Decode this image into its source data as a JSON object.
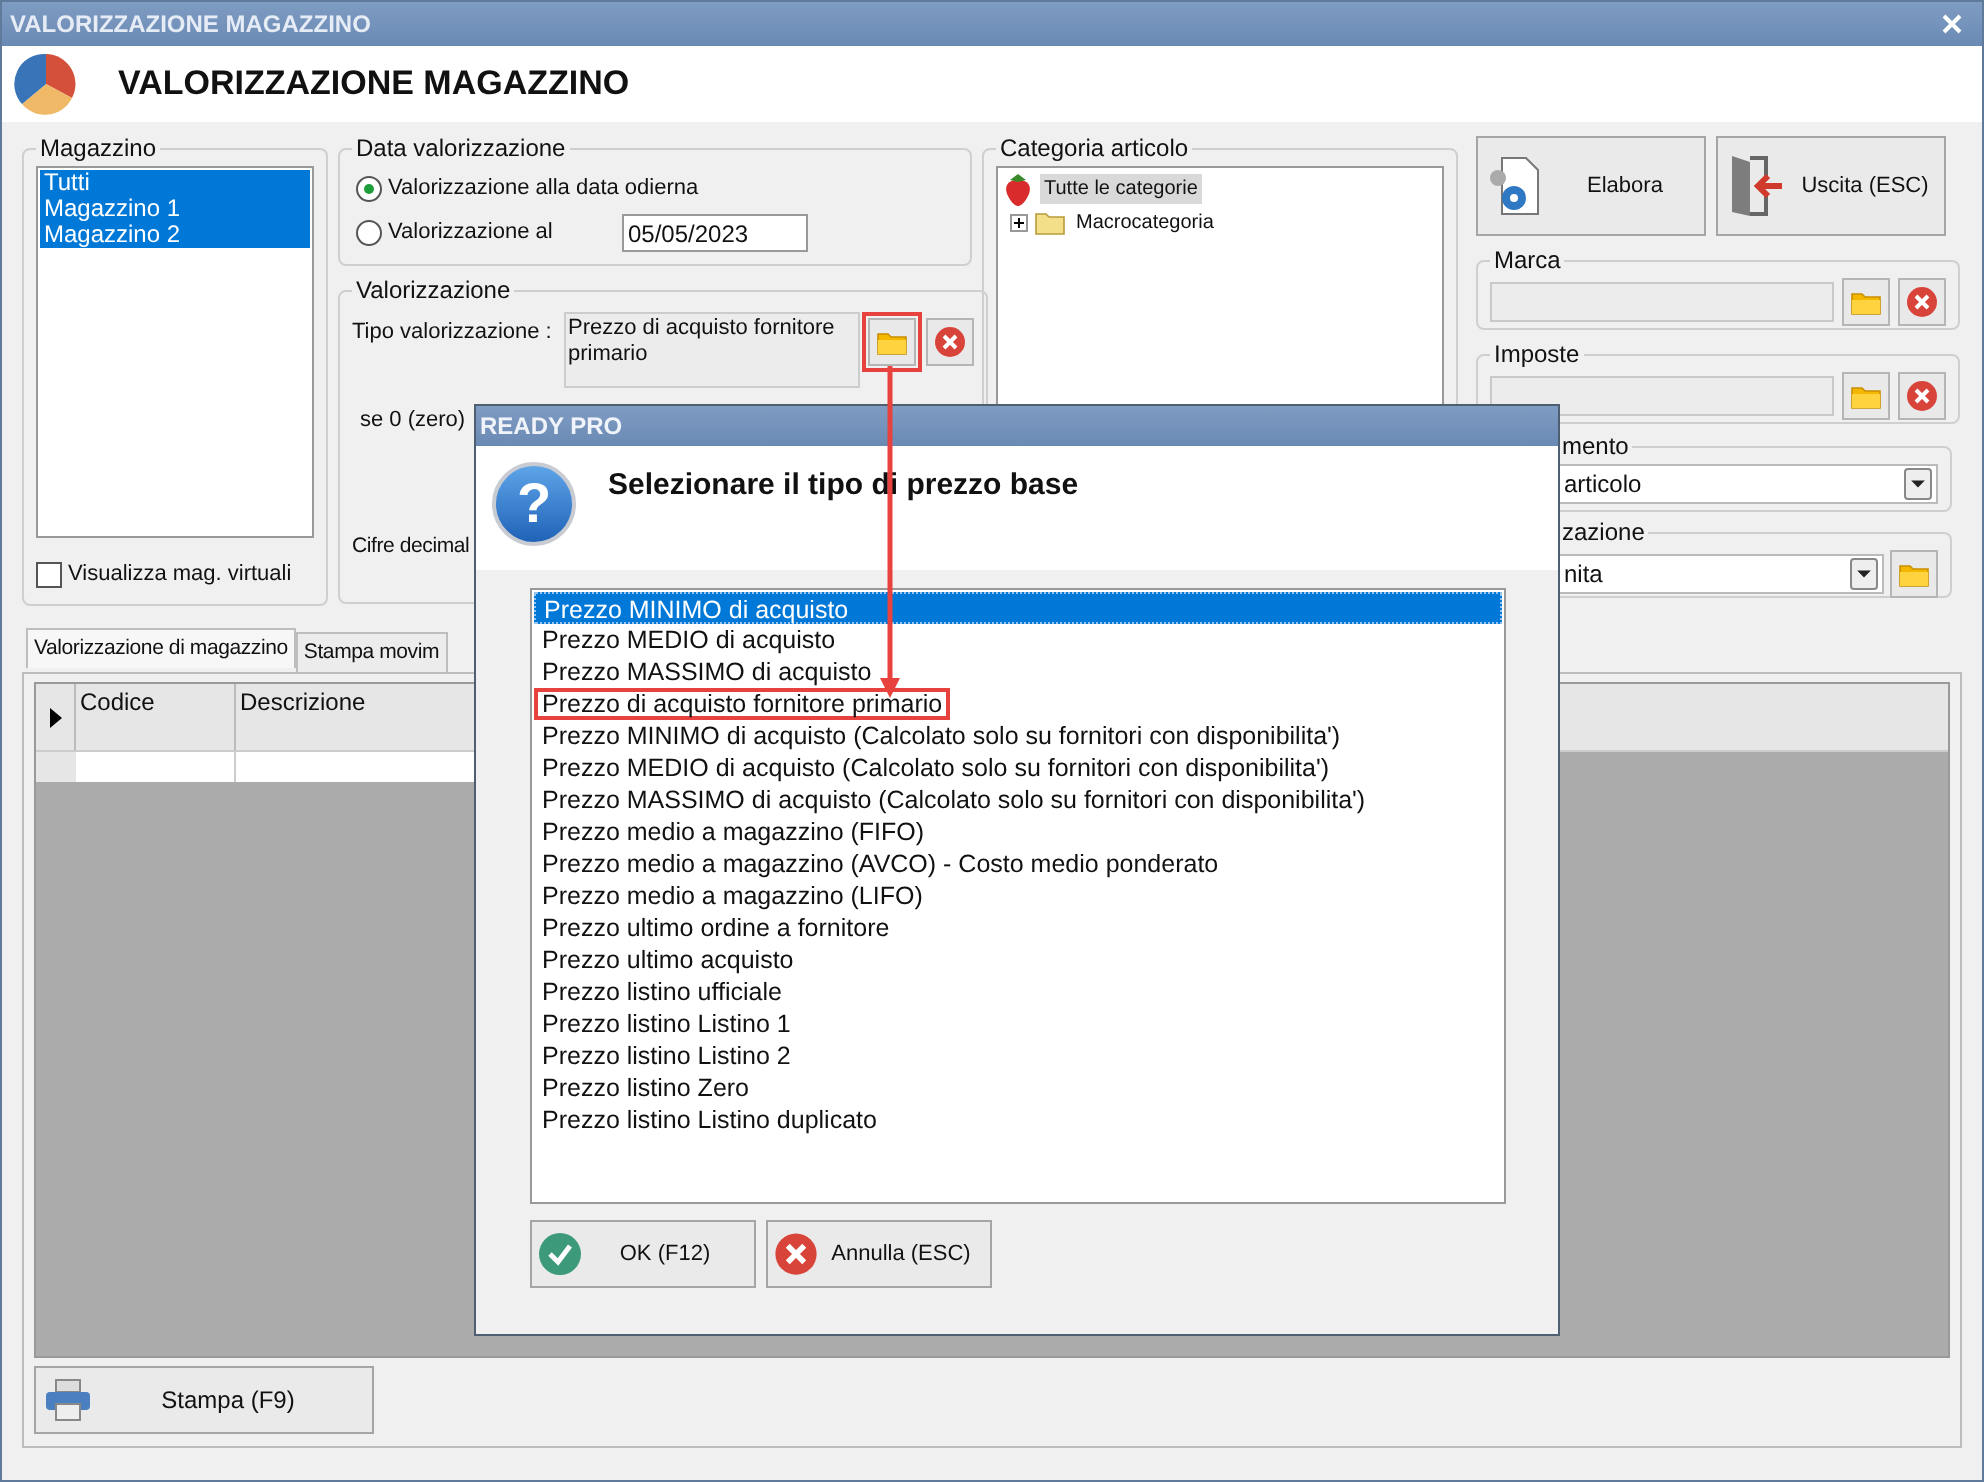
{
  "window": {
    "title": "VALORIZZAZIONE MAGAZZINO"
  },
  "header": {
    "title": "VALORIZZAZIONE MAGAZZINO"
  },
  "magazzino": {
    "label": "Magazzino",
    "items": [
      {
        "label": "Tutti",
        "selected": true
      },
      {
        "label": "Magazzino 1",
        "selected": true
      },
      {
        "label": "Magazzino 2",
        "selected": true
      }
    ],
    "virtual": {
      "label": "Visualizza mag. virtuali",
      "checked": false
    }
  },
  "data_valorizzazione": {
    "label": "Data valorizzazione",
    "options": [
      {
        "label": "Valorizzazione alla data odierna",
        "selected": true
      },
      {
        "label": "Valorizzazione al",
        "selected": false
      }
    ],
    "date": "05/05/2023"
  },
  "valorizzazione": {
    "label": "Valorizzazione",
    "tipo_label": "Tipo valorizzazione :",
    "tipo_value": "Prezzo di acquisto fornitore primario",
    "browse_annotated": true,
    "zero_label": "se 0 (zero)",
    "decimals_label": "Cifre decimal"
  },
  "categoria": {
    "label": "Categoria articolo",
    "tree": [
      {
        "label": "Tutte le categorie",
        "selected": true,
        "children": [
          {
            "label": "Macrocategoria",
            "selected": false,
            "expanded": false
          }
        ]
      }
    ]
  },
  "actions": [
    {
      "label": "Elabora",
      "kind": "process"
    },
    {
      "label": "Uscita (ESC)",
      "kind": "exit"
    }
  ],
  "marca": {
    "label": "Marca"
  },
  "imposte": {
    "label": "Imposte"
  },
  "group_5": {
    "label": "mento",
    "value": "articolo"
  },
  "group_6": {
    "label": "zazione",
    "value": "nita"
  },
  "tabs": [
    {
      "label": "Valorizzazione di magazzino",
      "selected": true
    },
    {
      "label": "Stampa movim",
      "selected": false
    }
  ],
  "table": {
    "columns": [
      "Codice",
      "Descrizione"
    ]
  },
  "print_button": {
    "label": "Stampa (F9)"
  },
  "dialog": {
    "title": "READY PRO",
    "icon_glyph": "?",
    "message": "Selezionare il tipo di prezzo base",
    "options": [
      {
        "label": "Prezzo MINIMO di acquisto",
        "selected": true,
        "annotated": false
      },
      {
        "label": "Prezzo MEDIO di acquisto",
        "selected": false,
        "annotated": false
      },
      {
        "label": "Prezzo MASSIMO di acquisto",
        "selected": false,
        "annotated": false
      },
      {
        "label": "Prezzo di acquisto fornitore primario",
        "selected": false,
        "annotated": true
      },
      {
        "label": "Prezzo MINIMO di acquisto (Calcolato solo su fornitori con disponibilita')",
        "selected": false,
        "annotated": false
      },
      {
        "label": "Prezzo MEDIO di acquisto (Calcolato solo su fornitori con disponibilita')",
        "selected": false,
        "annotated": false
      },
      {
        "label": "Prezzo MASSIMO di acquisto (Calcolato solo su fornitori con disponibilita')",
        "selected": false,
        "annotated": false
      },
      {
        "label": "Prezzo medio a magazzino (FIFO)",
        "selected": false,
        "annotated": false
      },
      {
        "label": "Prezzo medio a magazzino (AVCO) - Costo medio ponderato",
        "selected": false,
        "annotated": false
      },
      {
        "label": "Prezzo medio a magazzino (LIFO)",
        "selected": false,
        "annotated": false
      },
      {
        "label": "Prezzo ultimo ordine a fornitore",
        "selected": false,
        "annotated": false
      },
      {
        "label": "Prezzo ultimo acquisto",
        "selected": false,
        "annotated": false
      },
      {
        "label": "Prezzo listino ufficiale",
        "selected": false,
        "annotated": false
      },
      {
        "label": "Prezzo listino Listino 1",
        "selected": false,
        "annotated": false
      },
      {
        "label": "Prezzo listino Listino 2",
        "selected": false,
        "annotated": false
      },
      {
        "label": "Prezzo listino Zero",
        "selected": false,
        "annotated": false
      },
      {
        "label": "Prezzo listino Listino duplicato",
        "selected": false,
        "annotated": false
      }
    ],
    "buttons": [
      {
        "label": "OK (F12)",
        "kind": "ok"
      },
      {
        "label": "Annulla (ESC)",
        "kind": "cancel"
      }
    ]
  }
}
